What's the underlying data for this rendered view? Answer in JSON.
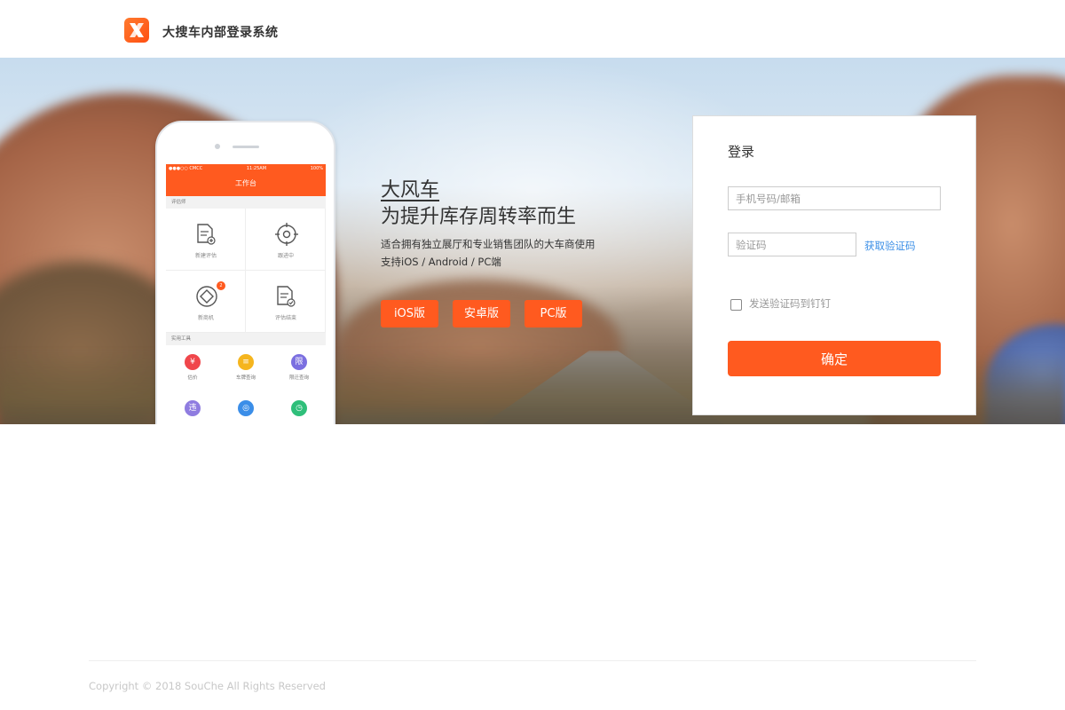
{
  "header": {
    "site_title": "大搜车内部登录系统"
  },
  "phone": {
    "status_carrier": "●●●○○ CMCC",
    "status_time": "11:25AM",
    "status_battery": "100%",
    "app_title": "工作台",
    "section1_label": "评估师",
    "tiles": [
      {
        "label": "新建评估",
        "icon": "document-add-icon"
      },
      {
        "label": "跟进中",
        "icon": "target-icon"
      },
      {
        "label": "新商机",
        "icon": "diamond-icon",
        "badge": "2"
      },
      {
        "label": "评估结束",
        "icon": "document-check-icon"
      }
    ],
    "section2_label": "实用工具",
    "tools": [
      {
        "label": "估价",
        "glyph": "¥",
        "color": "#f0464b"
      },
      {
        "label": "车牌查询",
        "glyph": "≡",
        "color": "#f5b51e"
      },
      {
        "label": "限迁查询",
        "glyph": "限",
        "color": "#7b6fe0"
      },
      {
        "label": "",
        "glyph": "违",
        "color": "#8f7ce0"
      },
      {
        "label": "",
        "glyph": "◎",
        "color": "#3b8ee8"
      },
      {
        "label": "",
        "glyph": "◷",
        "color": "#2fbf7a"
      }
    ]
  },
  "promo": {
    "brand": "大风车",
    "slogan": "为提升库存周转率而生",
    "desc_line1": "适合拥有独立展厅和专业销售团队的大车商使用",
    "desc_line2": "支持iOS / Android / PC端",
    "btn_ios": "iOS版",
    "btn_android": "安卓版",
    "btn_pc": "PC版"
  },
  "login": {
    "title": "登录",
    "account_placeholder": "手机号码/邮箱",
    "account_value": "",
    "code_placeholder": "验证码",
    "code_value": "",
    "get_code_label": "获取验证码",
    "dingding_label": "发送验证码到钉钉",
    "dingding_checked": false,
    "submit_label": "确定"
  },
  "footer": {
    "copyright": "Copyright © 2018 SouChe All Rights Reserved"
  },
  "colors": {
    "brand_orange": "#ff5a1f",
    "link_blue": "#3a8ee6"
  }
}
